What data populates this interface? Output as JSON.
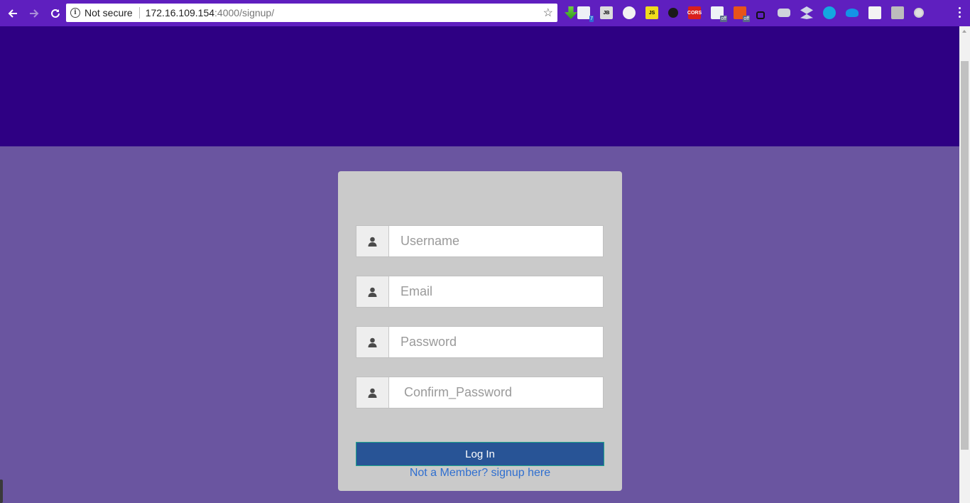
{
  "browser": {
    "security_label": "Not secure",
    "url_host": "172.16.109.154",
    "url_path": ":4000/signup/",
    "extensions": [
      {
        "icon": "download-arrow-icon",
        "badge": "7"
      },
      {
        "icon": "edit-page-icon"
      },
      {
        "icon": "jb-icon",
        "text": "JB"
      },
      {
        "icon": "circle-extension-icon"
      },
      {
        "icon": "js-icon",
        "text": "JS"
      },
      {
        "icon": "tool-icon"
      },
      {
        "icon": "cors-icon",
        "text": "CORS"
      },
      {
        "icon": "off-extension-icon",
        "badge": "off"
      },
      {
        "icon": "off-extension-orange-icon",
        "badge": "off"
      },
      {
        "icon": "lock-icon"
      },
      {
        "icon": "keyboard-icon"
      },
      {
        "icon": "dropbox-icon"
      },
      {
        "icon": "cyan-circle-icon"
      },
      {
        "icon": "cloud-icon"
      },
      {
        "icon": "feather-icon"
      },
      {
        "icon": "j-icon"
      },
      {
        "icon": "ring-icon"
      }
    ]
  },
  "form": {
    "username_placeholder": "Username",
    "email_placeholder": "Email",
    "password_placeholder": "Password",
    "confirm_placeholder": "Confirm_Password",
    "submit_label": "Log In",
    "signup_link": "Not a Member? signup here"
  },
  "colors": {
    "chrome": "#5f1fbf",
    "hero": "#2e0083",
    "page_bg": "#6a55a0",
    "card": "#cacaca",
    "button": "#285496",
    "link": "#2f6fd0"
  }
}
